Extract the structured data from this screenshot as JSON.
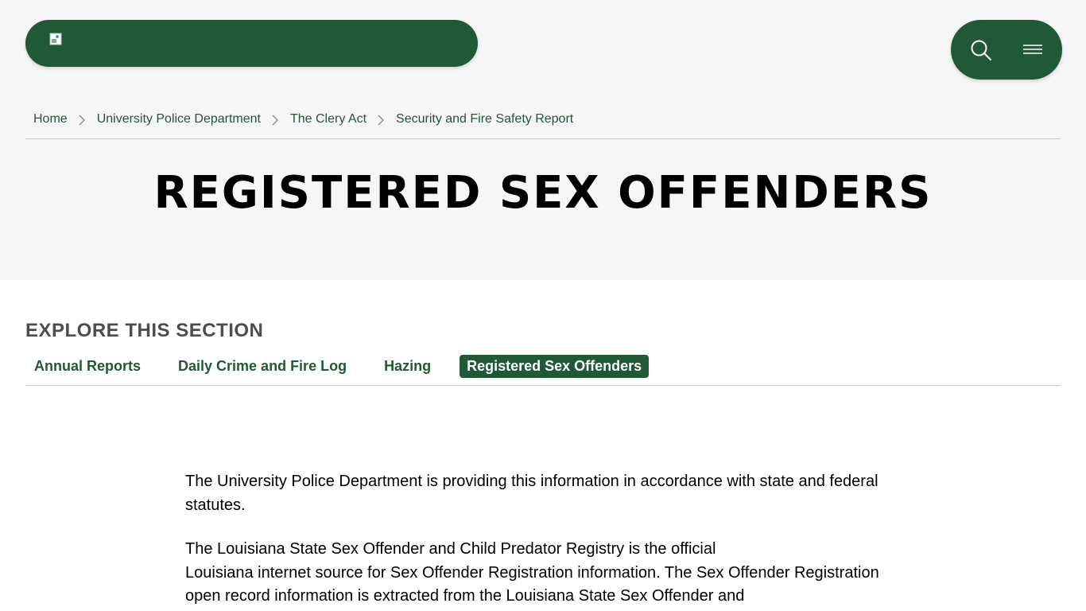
{
  "header": {
    "search_label": "search",
    "menu_label": "menu"
  },
  "breadcrumb": {
    "items": [
      {
        "label": "Home"
      },
      {
        "label": "University Police Department"
      },
      {
        "label": "The Clery Act"
      },
      {
        "label": "Security and Fire Safety Report"
      }
    ]
  },
  "page": {
    "title": "REGISTERED SEX OFFENDERS"
  },
  "section_nav": {
    "heading": "EXPLORE THIS SECTION",
    "items": [
      {
        "label": "Annual Reports"
      },
      {
        "label": "Daily Crime and Fire Log"
      },
      {
        "label": "Hazing"
      },
      {
        "label": "Registered Sex Offenders",
        "active": true
      }
    ]
  },
  "content": {
    "paragraphs": [
      " The University Police Department is providing this information in accordance with state and federal statutes.",
      "The Louisiana State Sex Offender and Child Predator Registry is the official\nLouisiana internet source for Sex Offender Registration information. The Sex Offender Registration open record information is extracted from the Louisiana State Sex Offender and"
    ]
  },
  "colors": {
    "brand_green": "#1f5935",
    "hero_bg": "#f6f6f6",
    "heading_gray": "#4d4d4d"
  },
  "icons": [
    "broken-image-icon",
    "search-icon",
    "menu-icon",
    "chevron-right-icon"
  ]
}
